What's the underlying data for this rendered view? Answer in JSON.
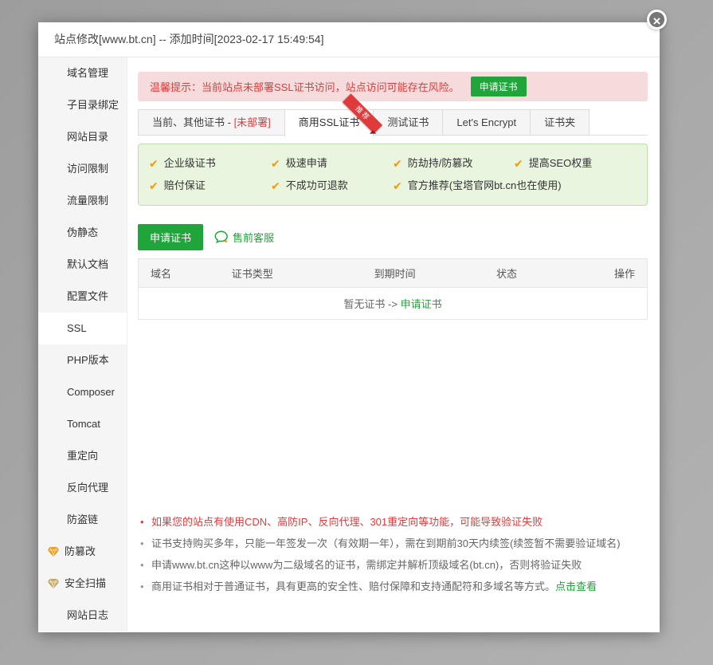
{
  "dialog": {
    "title": "站点修改[www.bt.cn] -- 添加时间[2023-02-17 15:49:54]",
    "close_glyph": "×"
  },
  "sidebar": {
    "items": [
      {
        "label": "域名管理"
      },
      {
        "label": "子目录绑定"
      },
      {
        "label": "网站目录"
      },
      {
        "label": "访问限制"
      },
      {
        "label": "流量限制"
      },
      {
        "label": "伪静态"
      },
      {
        "label": "默认文档"
      },
      {
        "label": "配置文件"
      },
      {
        "label": "SSL",
        "active": true
      },
      {
        "label": "PHP版本"
      },
      {
        "label": "Composer"
      },
      {
        "label": "Tomcat"
      },
      {
        "label": "重定向"
      },
      {
        "label": "反向代理"
      },
      {
        "label": "防盗链"
      },
      {
        "label": "防篡改",
        "premium": true
      },
      {
        "label": "安全扫描",
        "premium": true
      },
      {
        "label": "网站日志"
      }
    ]
  },
  "ssl": {
    "warning": {
      "text": "温馨提示：当前站点未部署SSL证书访问，站点访问可能存在风险。",
      "button": "申请证书"
    },
    "tabs": [
      {
        "label": "当前、其他证书 - ",
        "tag": "[未部署]"
      },
      {
        "label": "商用SSL证书",
        "active": true,
        "badge": "推荐"
      },
      {
        "label": "测试证书"
      },
      {
        "label": "Let's Encrypt"
      },
      {
        "label": "证书夹"
      }
    ],
    "features": [
      "企业级证书",
      "极速申请",
      "防劫持/防篡改",
      "提高SEO权重",
      "赔付保证",
      "不成功可退款",
      "官方推荐(宝塔官网bt.cn也在使用)"
    ],
    "apply_button": "申请证书",
    "presale_link": "售前客服",
    "table": {
      "headers": [
        "域名",
        "证书类型",
        "到期时间",
        "状态",
        "操作"
      ],
      "empty_text": "暂无证书 ->",
      "empty_link": "申请证书"
    },
    "notes": [
      {
        "text": "如果您的站点有使用CDN、高防IP、反向代理、301重定向等功能，可能导致验证失败"
      },
      {
        "text": "证书支持购买多年，只能一年签发一次（有效期一年），需在到期前30天内续签(续签暂不需要验证域名)"
      },
      {
        "text": "申请www.bt.cn这种以www为二级域名的证书，需绑定并解析顶级域名(bt.cn)，否则将验证失败"
      },
      {
        "text": "商用证书相对于普通证书，具有更高的安全性、赔付保障和支持通配符和多域名等方式。",
        "link": "点击查看"
      }
    ]
  },
  "colors": {
    "accent_green": "#20a53a",
    "warning_red": "#e03c3c",
    "check_orange": "#ff9700",
    "ribbon_red": "#e03a3a"
  }
}
